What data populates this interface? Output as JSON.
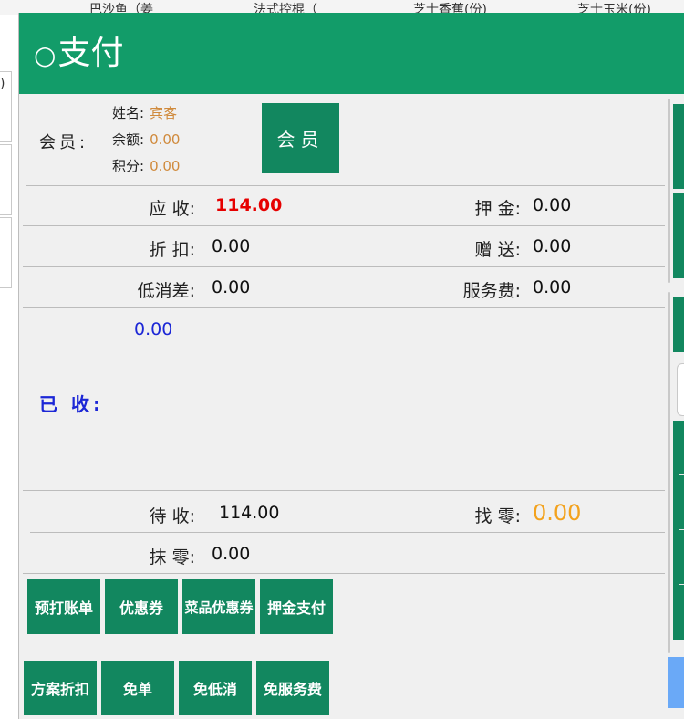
{
  "background": {
    "columns": [
      "巴沙鱼（姜",
      "法式控棍（",
      "芝士香蕉(份)",
      "芝士玉米(份)"
    ],
    "left_fragment": ")"
  },
  "modal": {
    "title": "支付",
    "title_icon": "○"
  },
  "member": {
    "label": "会员:",
    "name_label": "姓名:",
    "name_value": "宾客",
    "balance_label": "余额:",
    "balance_value": "0.00",
    "points_label": "积分:",
    "points_value": "0.00",
    "button_label": "会员"
  },
  "summary": {
    "receivable_label": "应 收:",
    "receivable_value": "114.00",
    "deposit_label": "押 金:",
    "deposit_value": "0.00",
    "discount_label": "折 扣:",
    "discount_value": "0.00",
    "gift_label": "赠 送:",
    "gift_value": "0.00",
    "min_diff_label": "低消差:",
    "min_diff_value": "0.00",
    "service_label": "服务费:",
    "service_value": "0.00",
    "paid_amount": "0.00",
    "paid_label": "已 收:",
    "pending_label": "待 收:",
    "pending_value": "114.00",
    "change_label": "找 零:",
    "change_value": "0.00",
    "rounding_label": "抹 零:",
    "rounding_value": "0.00"
  },
  "actions": {
    "row1": [
      "预打账单",
      "优惠券",
      "菜品优惠券",
      "押金支付"
    ],
    "row2": [
      "方案折扣",
      "免单",
      "免低消",
      "免服务费"
    ]
  },
  "colors": {
    "brand_green": "#129c69",
    "button_green": "#12875f",
    "receivable_red": "#e60000",
    "paid_blue": "#1c27d6",
    "change_orange": "#f3a21d"
  }
}
